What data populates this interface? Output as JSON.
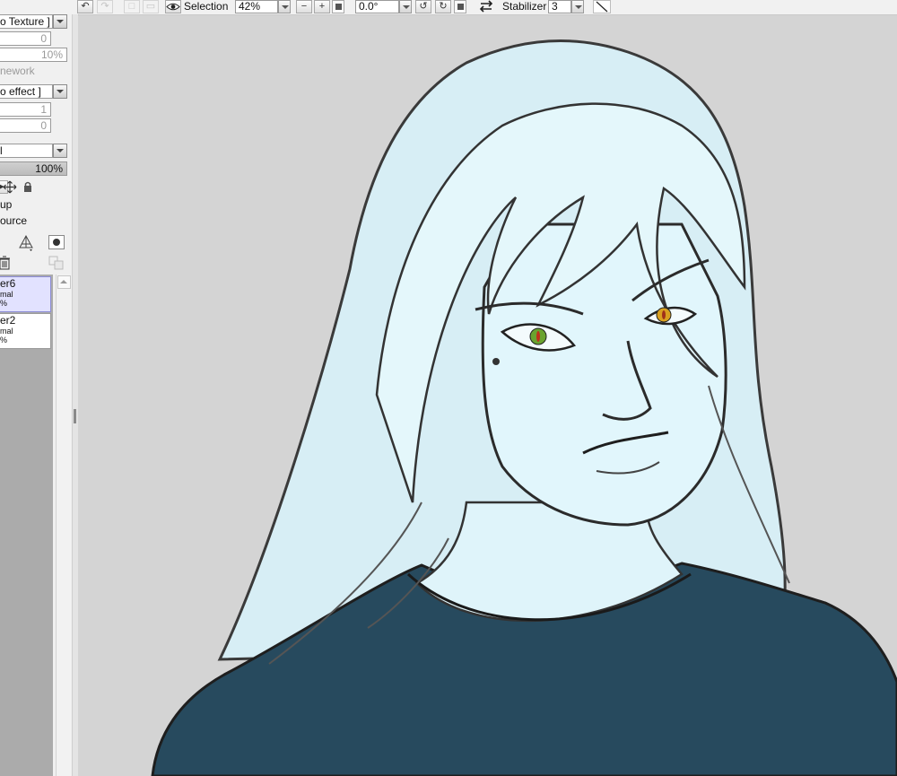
{
  "toolbar": {
    "undo_icon": "undo-icon",
    "redo_icon": "redo-icon",
    "selection_label": "Selection",
    "zoom_value": "42%",
    "rotation_value": "0.0°",
    "stabilizer_label": "Stabilizer",
    "stabilizer_value": "3"
  },
  "panel": {
    "texture_label": "o Texture ]",
    "texture_value_1": "0",
    "texture_value_2": "10%",
    "framework_label": "nework",
    "effect_label": "o effect ]",
    "effect_value_1": "1",
    "effect_value_2": "0",
    "blend_mode": "l",
    "opacity": "100%",
    "clip_group_label": "up",
    "selection_source_label": "ource"
  },
  "layers": [
    {
      "name": "er6",
      "mode": "mal",
      "opacity": "%"
    },
    {
      "name": "er2",
      "mode": "mal",
      "opacity": "%"
    }
  ],
  "colors": {
    "canvas_bg": "#d4d4d4",
    "skin": "#dff4fa",
    "shirt": "#274a5e",
    "eye_left": "#6aa32f",
    "eye_right": "#d9a020",
    "selected_layer": "#e2e2ff"
  }
}
